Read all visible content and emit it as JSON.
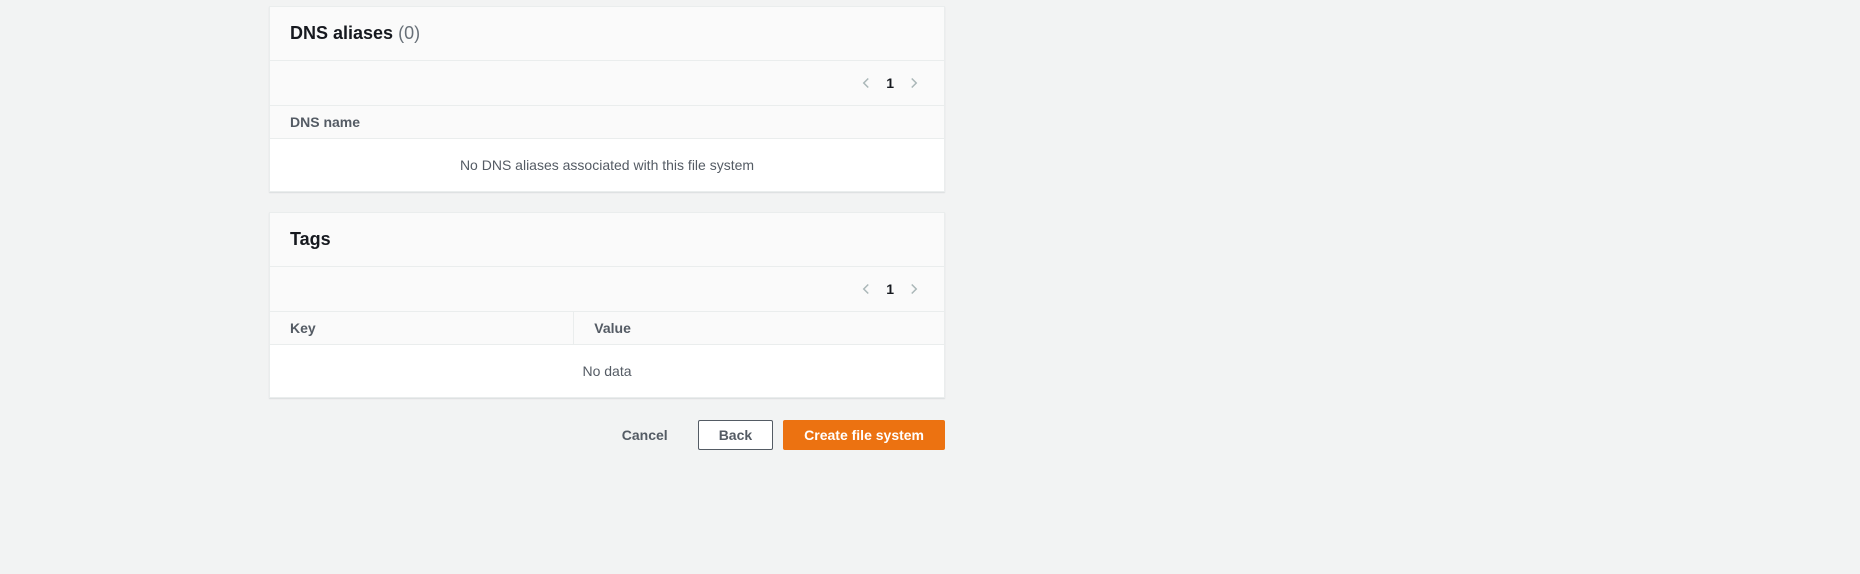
{
  "dns_panel": {
    "title": "DNS aliases",
    "count_label": "(0)",
    "pagination": {
      "current": "1"
    },
    "columns": {
      "dns_name": "DNS name"
    },
    "empty": "No DNS aliases associated with this file system"
  },
  "tags_panel": {
    "title": "Tags",
    "pagination": {
      "current": "1"
    },
    "columns": {
      "key": "Key",
      "value": "Value"
    },
    "empty": "No data"
  },
  "actions": {
    "cancel": "Cancel",
    "back": "Back",
    "create": "Create file system"
  }
}
